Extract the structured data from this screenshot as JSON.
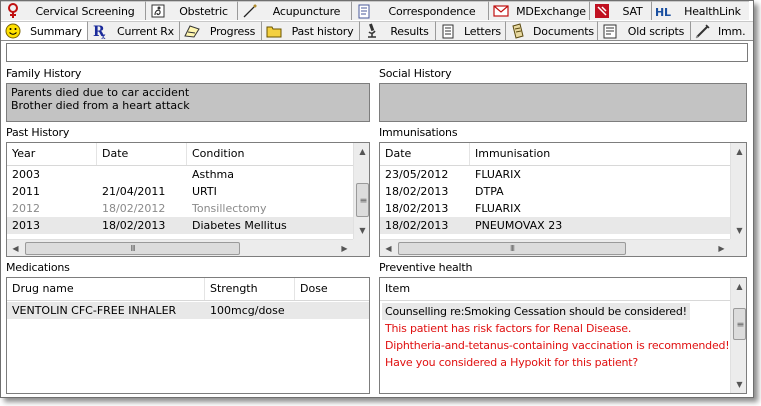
{
  "tabs_top": [
    {
      "label": "Cervical Screening",
      "icon": "cervical-icon"
    },
    {
      "label": "Obstetric",
      "icon": "obstetric-icon"
    },
    {
      "label": "Acupuncture",
      "icon": "acupuncture-needle-icon"
    },
    {
      "label": "Correspondence",
      "icon": "correspondence-icon"
    },
    {
      "label": "MDExchange",
      "icon": "envelope-icon"
    },
    {
      "label": "SAT",
      "icon": "sat-icon"
    },
    {
      "label": "HealthLink",
      "icon": "healthlink-icon"
    }
  ],
  "tabs_bottom": [
    {
      "label": "Summary",
      "icon": "smiley-icon",
      "active": true
    },
    {
      "label": "Current Rx",
      "icon": "rx-icon"
    },
    {
      "label": "Progress",
      "icon": "progress-icon"
    },
    {
      "label": "Past history",
      "icon": "folder-icon"
    },
    {
      "label": "Results",
      "icon": "microscope-icon"
    },
    {
      "label": "Letters",
      "icon": "letters-icon"
    },
    {
      "label": "Documents",
      "icon": "documents-icon"
    },
    {
      "label": "Old scripts",
      "icon": "old-scripts-icon"
    },
    {
      "label": "Imm.",
      "icon": "syringe-icon"
    }
  ],
  "family_history": {
    "title": "Family History",
    "lines": [
      "Parents died due to car accident",
      "Brother died from a heart attack"
    ]
  },
  "social_history": {
    "title": "Social History",
    "lines": []
  },
  "past_history": {
    "title": "Past History",
    "columns": [
      "Year",
      "Date",
      "Condition"
    ],
    "rows": [
      {
        "year": "2003",
        "date": "",
        "condition": "Asthma",
        "inactive": false,
        "selected": false
      },
      {
        "year": "2011",
        "date": "21/04/2011",
        "condition": "URTI",
        "inactive": false,
        "selected": false
      },
      {
        "year": "2012",
        "date": "18/02/2012",
        "condition": "Tonsillectomy",
        "inactive": true,
        "selected": false
      },
      {
        "year": "2013",
        "date": "18/02/2013",
        "condition": "Diabetes Mellitus",
        "inactive": false,
        "selected": true
      }
    ]
  },
  "immunisations": {
    "title": "Immunisations",
    "columns": [
      "Date",
      "Immunisation"
    ],
    "rows": [
      {
        "date": "23/05/2012",
        "name": "FLUARIX",
        "selected": false
      },
      {
        "date": "18/02/2013",
        "name": "DTPA",
        "selected": false
      },
      {
        "date": "18/02/2013",
        "name": "FLUARIX",
        "selected": false
      },
      {
        "date": "18/02/2013",
        "name": "PNEUMOVAX 23",
        "selected": true
      }
    ]
  },
  "medications": {
    "title": "Medications",
    "columns": [
      "Drug name",
      "Strength",
      "Dose"
    ],
    "rows": [
      {
        "drug": "VENTOLIN CFC-FREE INHALER",
        "strength": "100mcg/dose",
        "dose": ""
      }
    ]
  },
  "preventive_health": {
    "title": "Preventive health",
    "column": "Item",
    "items": [
      {
        "text": "Counselling re:Smoking Cessation should be considered!",
        "color": "#000000"
      },
      {
        "text": "This patient has risk factors for Renal Disease.",
        "color": "#e01010"
      },
      {
        "text": "Diphtheria-and-tetanus-containing vaccination is recommended!",
        "color": "#e01010"
      },
      {
        "text": "Have you considered a Hypokit for this patient?",
        "color": "#e01010"
      }
    ]
  },
  "scroll_grip": "III"
}
